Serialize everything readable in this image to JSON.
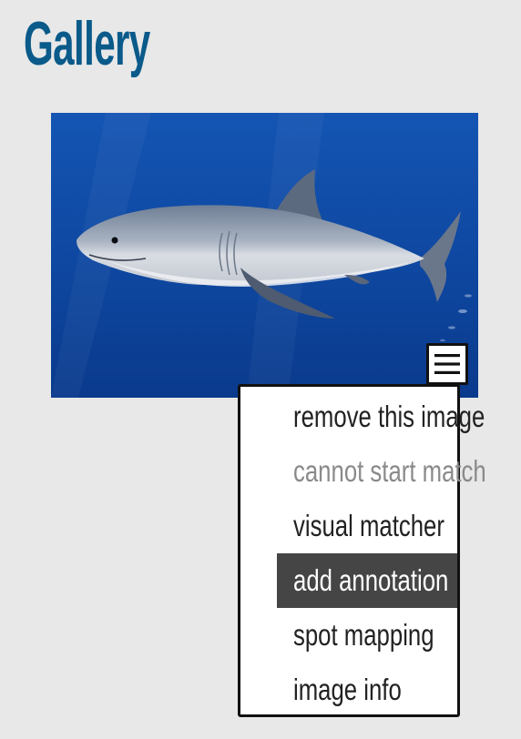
{
  "page": {
    "title": "Gallery"
  },
  "image": {
    "subject": "great white shark",
    "menu_icon": "hamburger-icon"
  },
  "menu": {
    "items": [
      {
        "label": "remove this image",
        "state": "enabled"
      },
      {
        "label": "cannot start match",
        "state": "disabled"
      },
      {
        "label": "visual matcher",
        "state": "enabled"
      },
      {
        "label": "add annotation",
        "state": "highlighted"
      },
      {
        "label": "spot mapping",
        "state": "enabled"
      },
      {
        "label": "image info",
        "state": "enabled"
      }
    ]
  },
  "colors": {
    "background": "#e8e8e8",
    "title": "#0a5a8a",
    "menu_highlight": "#454545",
    "menu_disabled_text": "#8a8a8a",
    "ocean": "#0f4fa8"
  }
}
